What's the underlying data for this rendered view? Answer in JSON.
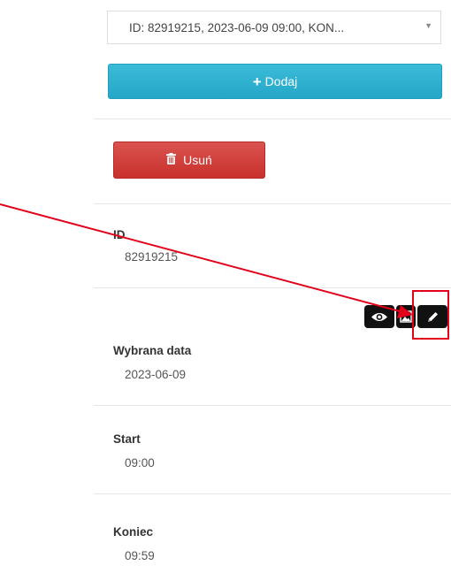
{
  "select": {
    "value": "ID: 82919215, 2023-06-09 09:00, KON...",
    "arrow": "▼"
  },
  "buttons": {
    "add_label": "Dodaj",
    "add_icon": "plus-icon",
    "delete_label": "Usuń",
    "delete_icon": "trash-icon"
  },
  "actions": {
    "icons": [
      "eye-icon",
      "image-icon",
      "pencil-icon"
    ]
  },
  "fields": {
    "id": {
      "label": "ID",
      "value": "82919215"
    },
    "date": {
      "label": "Wybrana data",
      "value": "2023-06-09"
    },
    "start": {
      "label": "Start",
      "value": "09:00"
    },
    "end": {
      "label": "Koniec",
      "value": "09:59"
    }
  },
  "colors": {
    "add_button": "#2aaed0",
    "delete_button": "#d0403c",
    "annotation": "#e3001b",
    "action_icon_bg": "#111111"
  }
}
